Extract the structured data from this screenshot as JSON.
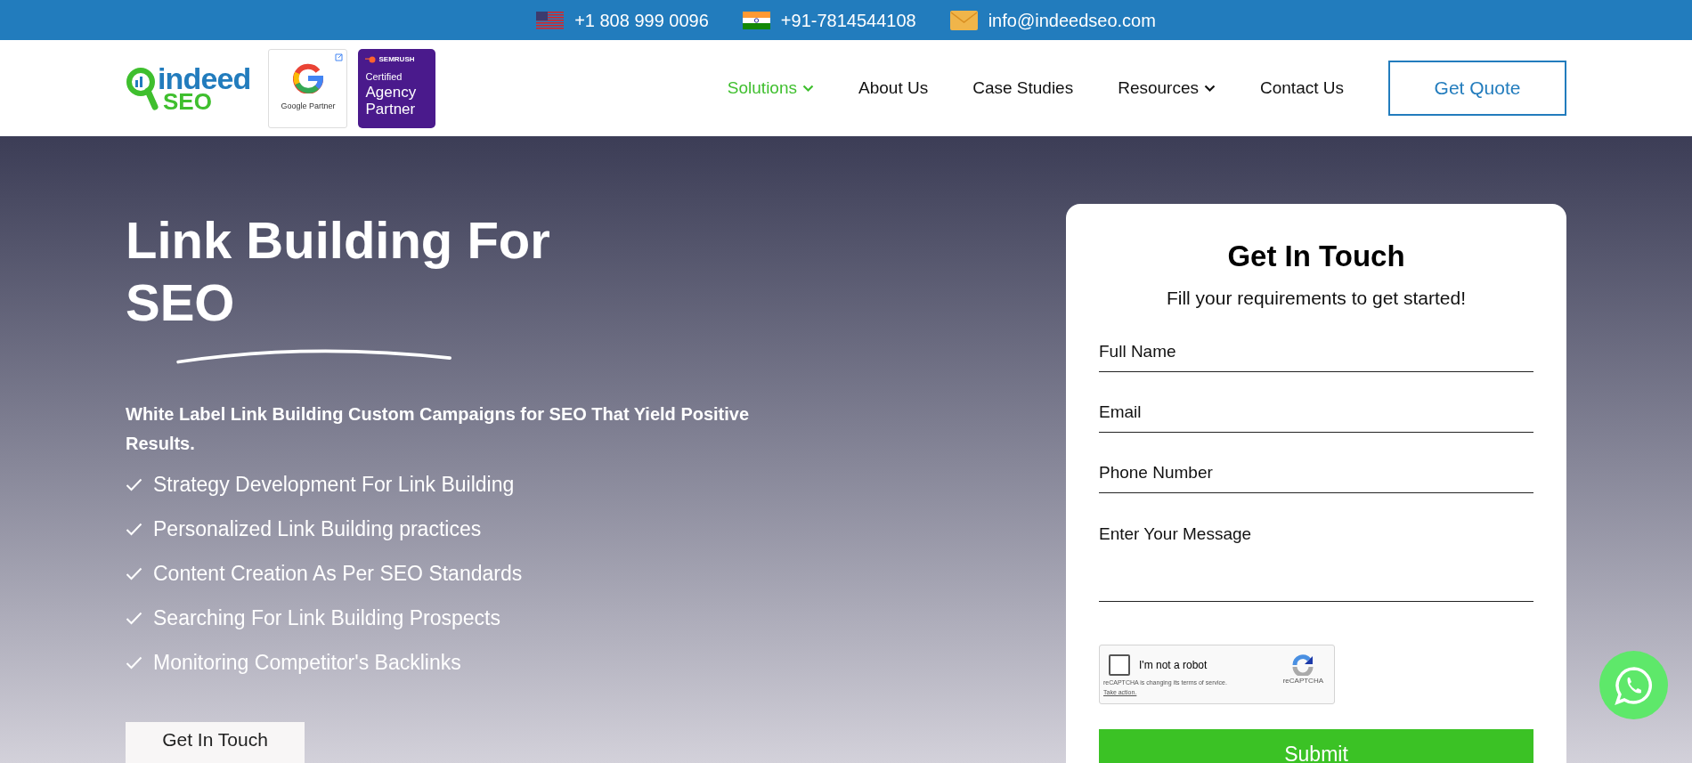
{
  "top_bar": {
    "contacts": [
      {
        "kind": "flag-us",
        "text": "+1 808 999 0096"
      },
      {
        "kind": "flag-in",
        "text": "+91-7814544108"
      },
      {
        "kind": "mail",
        "text": "info@indeedseo.com"
      }
    ]
  },
  "header": {
    "logo": {
      "word_1": "indeed",
      "word_2": "SEO"
    },
    "badges": [
      {
        "kind": "google",
        "text": "Google Partner"
      },
      {
        "kind": "semrush",
        "brand": "SEMRUSH",
        "line_1": "Certified",
        "line_2": "Agency Partner"
      }
    ],
    "nav": [
      {
        "label": "Solutions",
        "selected": true,
        "dropdown": true
      },
      {
        "label": "About Us",
        "selected": false,
        "dropdown": false
      },
      {
        "label": "Case Studies",
        "selected": false,
        "dropdown": false
      },
      {
        "label": "Resources",
        "selected": false,
        "dropdown": true
      },
      {
        "label": "Contact Us",
        "selected": false,
        "dropdown": false
      }
    ],
    "cta": "Get Quote"
  },
  "hero": {
    "title_line_1": "Link Building For",
    "title_line_2": "SEO",
    "subtitle": "White Label Link Building Custom Campaigns for SEO That Yield Positive Results.",
    "features": [
      "Strategy Development For Link Building",
      "Personalized Link Building practices",
      "Content Creation As Per SEO Standards",
      "Searching For Link Building Prospects",
      "Monitoring Competitor's Backlinks"
    ],
    "button": "Get In Touch"
  },
  "form": {
    "title": "Get In Touch",
    "subtitle": "Fill your requirements to get started!",
    "fields": [
      {
        "kind": "line",
        "placeholder": "Full Name"
      },
      {
        "kind": "line",
        "placeholder": "Email"
      },
      {
        "kind": "line",
        "placeholder": "Phone Number"
      },
      {
        "kind": "area",
        "placeholder": "Enter Your Message"
      }
    ],
    "captcha": {
      "label": "I'm not a robot",
      "checked": false,
      "brand": "reCAPTCHA",
      "notice": "reCAPTCHA is changing its terms of service.",
      "link": "Take action."
    },
    "submit": "Submit"
  }
}
